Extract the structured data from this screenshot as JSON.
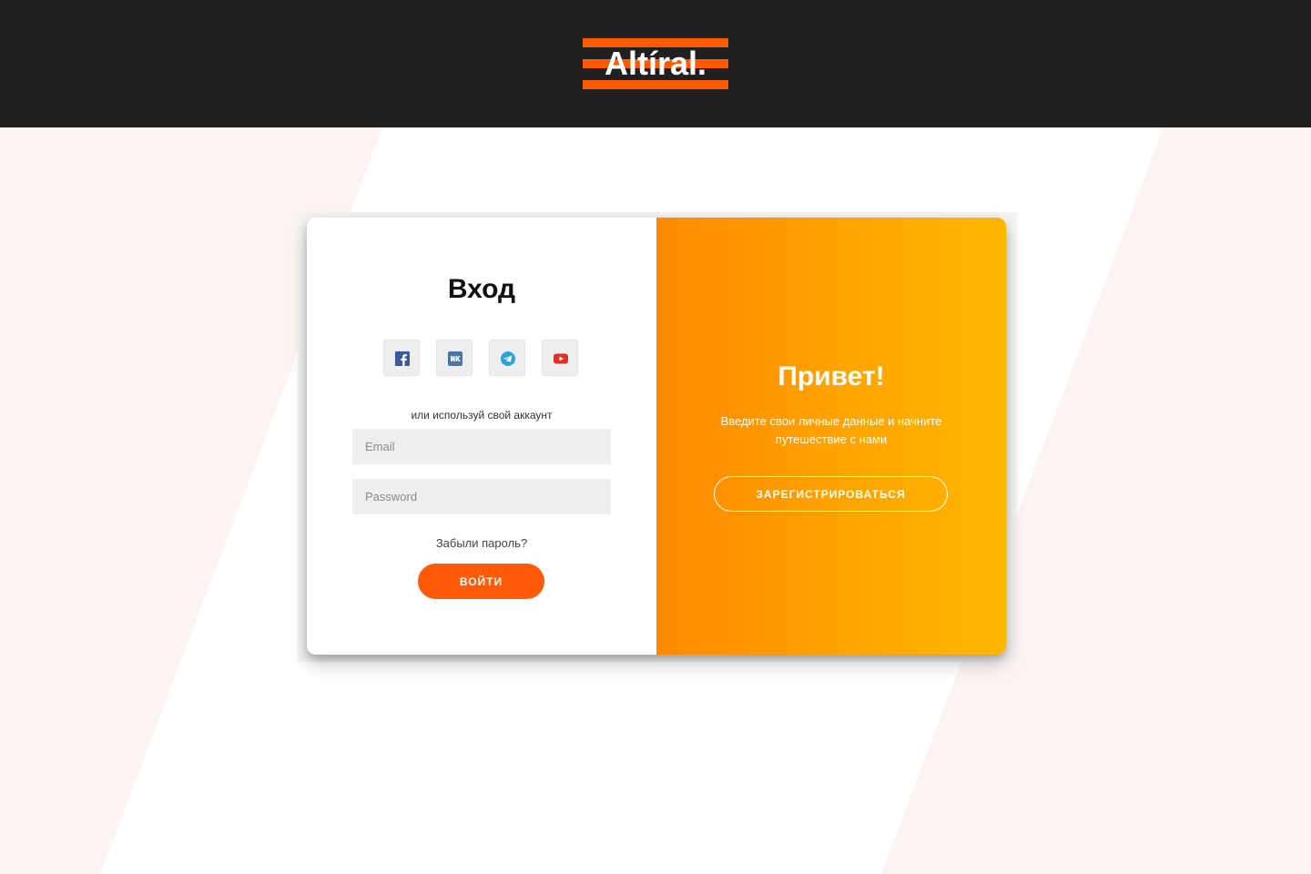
{
  "header": {
    "logo_text": "Altíral."
  },
  "colors": {
    "header_bg": "#202020",
    "brand_orange": "#ff5a00",
    "accent_gradient_start": "#ff8a00",
    "accent_gradient_end": "#ffb700",
    "page_bg": "#fdf3f0"
  },
  "login": {
    "title": "Вход",
    "social": [
      {
        "name": "facebook",
        "icon": "facebook-icon"
      },
      {
        "name": "vk",
        "icon": "vk-icon"
      },
      {
        "name": "telegram",
        "icon": "telegram-icon"
      },
      {
        "name": "youtube",
        "icon": "youtube-icon"
      }
    ],
    "or_text": "или используй свой аккаунт",
    "email_placeholder": "Email",
    "password_placeholder": "Password",
    "forgot_text": "Забыли пароль?",
    "submit_label": "ВОЙТИ"
  },
  "welcome": {
    "title": "Привет!",
    "text": "Введите свои личные данные и начните путешествие с нами",
    "register_label": "ЗАРЕГИСТРИРОВАТЬСЯ"
  }
}
